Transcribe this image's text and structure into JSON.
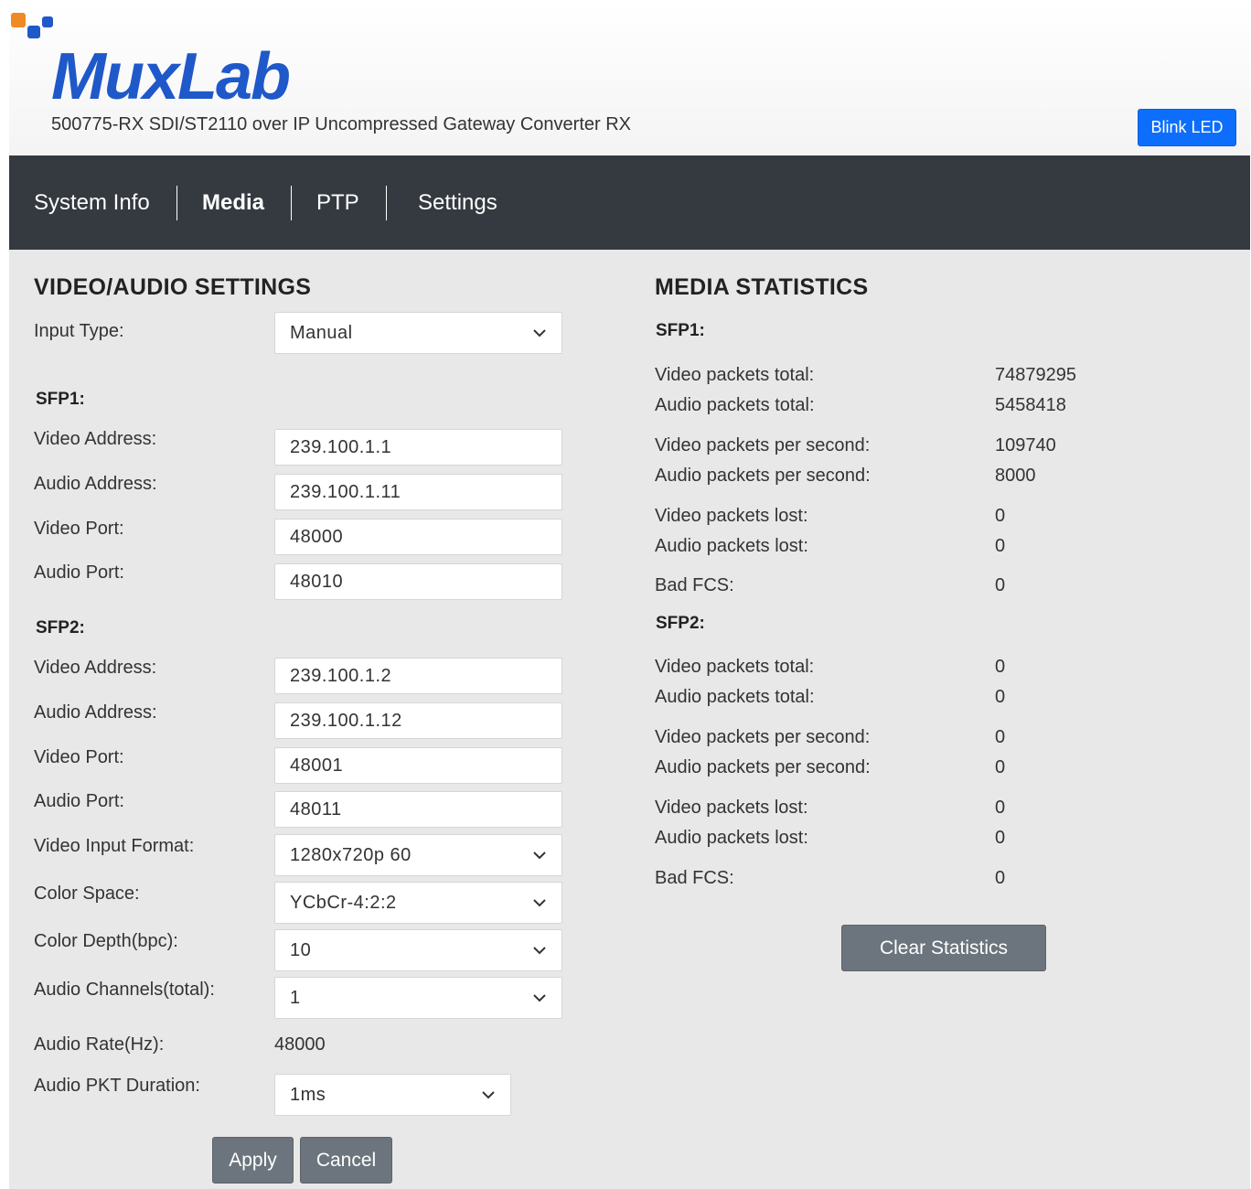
{
  "header": {
    "logo_text": "MuxLab",
    "subtitle": "500775-RX SDI/ST2110 over IP Uncompressed Gateway Converter RX",
    "blink_button": "Blink LED"
  },
  "nav": {
    "items": [
      {
        "label": "System Info",
        "active": false
      },
      {
        "label": "Media",
        "active": true
      },
      {
        "label": "PTP",
        "active": false
      },
      {
        "label": "Settings",
        "active": false
      }
    ]
  },
  "settings": {
    "title": "VIDEO/AUDIO SETTINGS",
    "input_type": {
      "label": "Input Type:",
      "value": "Manual"
    },
    "sfp1": {
      "heading": "SFP1:",
      "video_address": {
        "label": "Video Address:",
        "value": "239.100.1.1"
      },
      "audio_address": {
        "label": "Audio Address:",
        "value": "239.100.1.11"
      },
      "video_port": {
        "label": "Video Port:",
        "value": "48000"
      },
      "audio_port": {
        "label": "Audio Port:",
        "value": "48010"
      }
    },
    "sfp2": {
      "heading": "SFP2:",
      "video_address": {
        "label": "Video Address:",
        "value": "239.100.1.2"
      },
      "audio_address": {
        "label": "Audio Address:",
        "value": "239.100.1.12"
      },
      "video_port": {
        "label": "Video Port:",
        "value": "48001"
      },
      "audio_port": {
        "label": "Audio Port:",
        "value": "48011"
      }
    },
    "video_input_format": {
      "label": "Video Input Format:",
      "value": "1280x720p 60"
    },
    "color_space": {
      "label": "Color Space:",
      "value": "YCbCr-4:2:2"
    },
    "color_depth": {
      "label": "Color Depth(bpc):",
      "value": "10"
    },
    "audio_channels": {
      "label": "Audio Channels(total):",
      "value": "1"
    },
    "audio_rate": {
      "label": "Audio Rate(Hz):",
      "value": "48000"
    },
    "audio_pkt_duration": {
      "label": "Audio PKT Duration:",
      "value": "1ms"
    },
    "apply": "Apply",
    "cancel": "Cancel"
  },
  "stats": {
    "title": "MEDIA STATISTICS",
    "sfp1": {
      "heading": "SFP1:",
      "video_total": {
        "label": "Video packets total:",
        "value": "74879295"
      },
      "audio_total": {
        "label": "Audio packets total:",
        "value": "5458418"
      },
      "video_pps": {
        "label": "Video packets per second:",
        "value": "109740"
      },
      "audio_pps": {
        "label": "Audio packets per second:",
        "value": "8000"
      },
      "video_lost": {
        "label": "Video packets lost:",
        "value": "0"
      },
      "audio_lost": {
        "label": "Audio packets lost:",
        "value": "0"
      },
      "bad_fcs": {
        "label": "Bad FCS:",
        "value": "0"
      }
    },
    "sfp2": {
      "heading": "SFP2:",
      "video_total": {
        "label": "Video packets total:",
        "value": "0"
      },
      "audio_total": {
        "label": "Audio packets total:",
        "value": "0"
      },
      "video_pps": {
        "label": "Video packets per second:",
        "value": "0"
      },
      "audio_pps": {
        "label": "Audio packets per second:",
        "value": "0"
      },
      "video_lost": {
        "label": "Video packets lost:",
        "value": "0"
      },
      "audio_lost": {
        "label": "Audio packets lost:",
        "value": "0"
      },
      "bad_fcs": {
        "label": "Bad FCS:",
        "value": "0"
      }
    },
    "clear_button": "Clear Statistics"
  },
  "colors": {
    "navbar": "#343a40",
    "primary": "#0d6efd",
    "secondary": "#6c757d",
    "logo_blue": "#1f58c9",
    "logo_orange": "#f08a24"
  }
}
